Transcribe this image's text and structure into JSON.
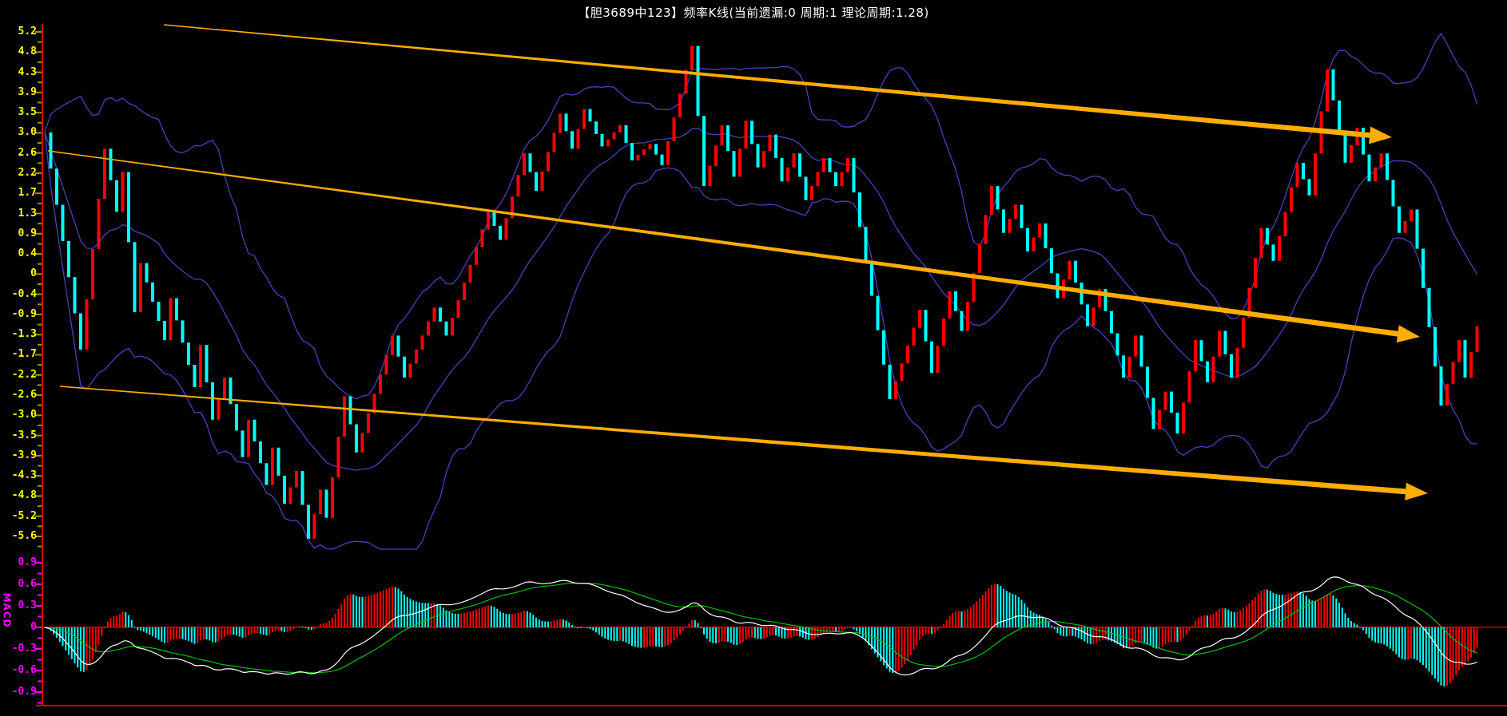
{
  "title_bar": {
    "title": "【胆3689中123】频率K线(当前遗漏:0  周期:1  理论周期:1.28)"
  },
  "chart_data": {
    "type": "candlestick",
    "title": "【胆3689中123】频率K线(当前遗漏:0  周期:1  理论周期:1.28)",
    "xlabel": "",
    "ylabel": "",
    "grid": "off",
    "legend": "none",
    "panels": [
      "price-kline-with-bollinger",
      "macd"
    ],
    "y_axis": {
      "labels": [
        "5.2",
        "4.8",
        "4.3",
        "3.9",
        "3.5",
        "3.0",
        "2.6",
        "2.2",
        "1.7",
        "1.3",
        "0.9",
        "0.4",
        "0",
        "-0.4",
        "-0.9",
        "-1.3",
        "-1.7",
        "-2.2",
        "-2.6",
        "-3.0",
        "-3.5",
        "-3.9",
        "-4.3",
        "-4.8",
        "-5.2",
        "-5.6"
      ],
      "ylim": [
        -5.9,
        5.4
      ],
      "color": "#ffff00"
    },
    "macd_axis": {
      "labels": [
        "0.9",
        "0.6",
        "0.3",
        "0",
        "-0.3",
        "-0.6",
        "-0.9"
      ],
      "ylim": [
        -1.1,
        1.1
      ],
      "color": "#ff00ff",
      "indicator_label": "MACD"
    },
    "price_pivots": [
      [
        0,
        3.05
      ],
      [
        6,
        -1.6
      ],
      [
        10,
        2.7
      ],
      [
        12,
        1.35
      ],
      [
        13,
        2.2
      ],
      [
        15,
        -0.8
      ],
      [
        16,
        0.25
      ],
      [
        20,
        -1.4
      ],
      [
        21,
        -0.5
      ],
      [
        25,
        -2.4
      ],
      [
        26,
        -1.5
      ],
      [
        28,
        -3.1
      ],
      [
        30,
        -2.2
      ],
      [
        33,
        -3.9
      ],
      [
        34,
        -3.1
      ],
      [
        37,
        -4.5
      ],
      [
        38,
        -3.7
      ],
      [
        40,
        -4.9
      ],
      [
        42,
        -4.2
      ],
      [
        44,
        -5.65
      ],
      [
        46,
        -4.6
      ],
      [
        47,
        -5.2
      ],
      [
        50,
        -2.6
      ],
      [
        52,
        -3.8
      ],
      [
        58,
        -1.3
      ],
      [
        60,
        -2.2
      ],
      [
        65,
        -0.7
      ],
      [
        67,
        -1.3
      ],
      [
        74,
        1.35
      ],
      [
        76,
        0.75
      ],
      [
        80,
        2.6
      ],
      [
        82,
        1.8
      ],
      [
        86,
        3.45
      ],
      [
        88,
        2.7
      ],
      [
        90,
        3.55
      ],
      [
        93,
        2.75
      ],
      [
        96,
        3.2
      ],
      [
        98,
        2.45
      ],
      [
        101,
        2.8
      ],
      [
        103,
        2.35
      ],
      [
        108,
        4.9
      ],
      [
        110,
        1.9
      ],
      [
        113,
        3.2
      ],
      [
        115,
        2.1
      ],
      [
        117,
        3.3
      ],
      [
        119,
        2.3
      ],
      [
        121,
        3.0
      ],
      [
        123,
        2.0
      ],
      [
        125,
        2.6
      ],
      [
        127,
        1.6
      ],
      [
        130,
        2.5
      ],
      [
        132,
        1.9
      ],
      [
        134,
        2.5
      ],
      [
        141,
        -2.66
      ],
      [
        146,
        -0.75
      ],
      [
        148,
        -2.1
      ],
      [
        151,
        -0.35
      ],
      [
        153,
        -1.2
      ],
      [
        158,
        1.9
      ],
      [
        160,
        0.9
      ],
      [
        162,
        1.5
      ],
      [
        164,
        0.5
      ],
      [
        166,
        1.1
      ],
      [
        169,
        -0.5
      ],
      [
        171,
        0.3
      ],
      [
        174,
        -1.1
      ],
      [
        176,
        -0.3
      ],
      [
        180,
        -2.2
      ],
      [
        182,
        -1.3
      ],
      [
        185,
        -3.3
      ],
      [
        187,
        -2.5
      ],
      [
        189,
        -3.4
      ],
      [
        192,
        -1.4
      ],
      [
        194,
        -2.3
      ],
      [
        196,
        -1.2
      ],
      [
        198,
        -2.2
      ],
      [
        203,
        1.0
      ],
      [
        205,
        0.3
      ],
      [
        209,
        2.4
      ],
      [
        211,
        1.7
      ],
      [
        214,
        4.4
      ],
      [
        217,
        2.4
      ],
      [
        219,
        3.15
      ],
      [
        221,
        2.0
      ],
      [
        223,
        2.6
      ],
      [
        226,
        0.9
      ],
      [
        228,
        1.4
      ],
      [
        233,
        -2.8
      ],
      [
        236,
        -1.4
      ],
      [
        237,
        -2.2
      ],
      [
        239,
        -1.1
      ]
    ],
    "bollinger": {
      "window": 20,
      "k": 2.0
    },
    "macd_params": {
      "fast": 24,
      "slow": 52,
      "signal": 18
    },
    "arrows": [
      {
        "from": [
          205,
          31
        ],
        "to": [
          1742,
          172
        ]
      },
      {
        "from": [
          60,
          189
        ],
        "to": [
          1777,
          422
        ]
      },
      {
        "from": [
          75,
          484
        ],
        "to": [
          1787,
          618
        ]
      }
    ],
    "colors": {
      "background": "#000000",
      "up": "#ff0000",
      "down": "#00ffff",
      "band": "#4c40b8",
      "dif": "#ffffff",
      "dea": "#00c000",
      "arrow": "#ffad00",
      "frame": "#dd0000",
      "tick_main": "#a89000",
      "tick_macd": "#ff00ff",
      "label_main": "#ffff00",
      "label_macd": "#ff00ff",
      "title": "#ffffff"
    }
  }
}
